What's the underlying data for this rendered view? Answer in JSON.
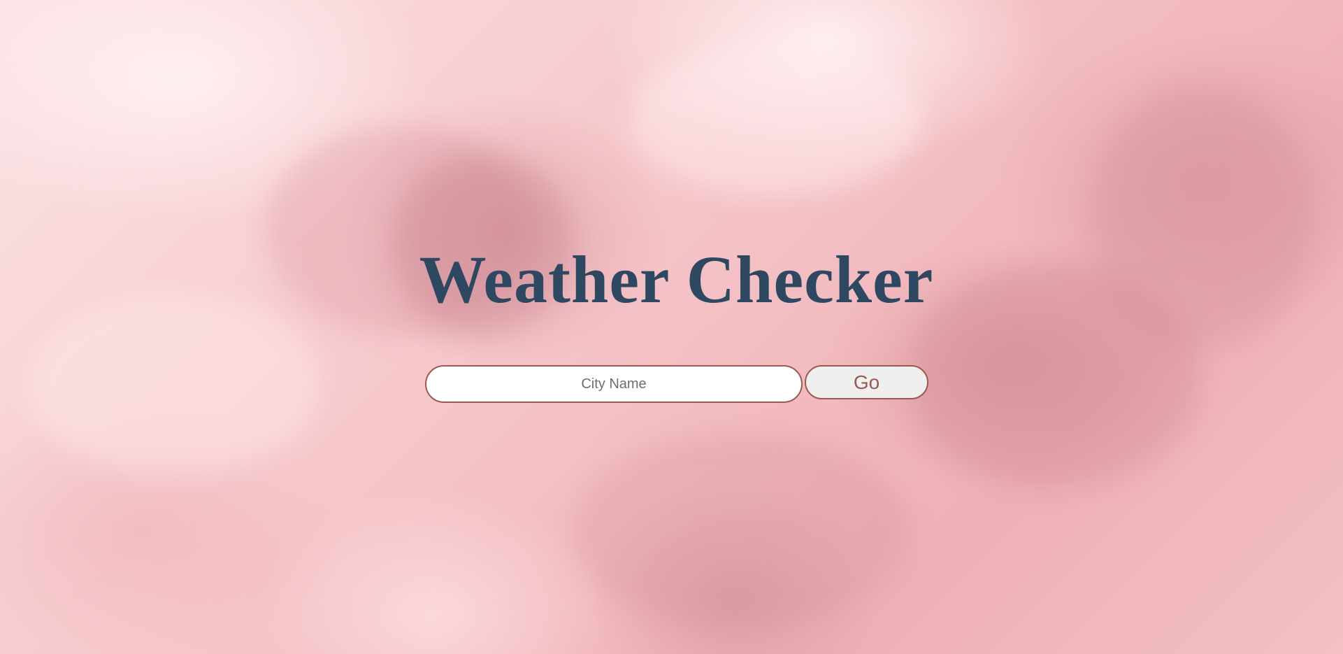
{
  "page": {
    "title": "Weather Checker"
  },
  "search": {
    "placeholder": "City Name",
    "value": "",
    "button_label": "Go"
  },
  "colors": {
    "title": "#2f4862",
    "accent_border": "#9a5a52",
    "button_background": "#efefef",
    "input_background": "#ffffff",
    "background_pink": "#f6c9cc"
  }
}
